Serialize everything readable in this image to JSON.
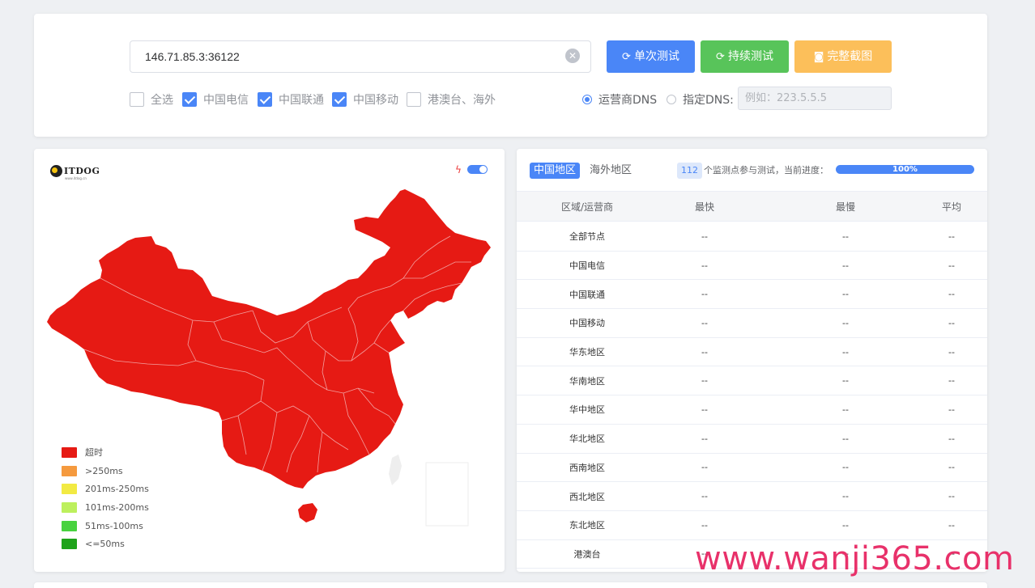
{
  "top": {
    "ip_value": "146.71.85.3:36122",
    "buttons": {
      "single": "单次测试",
      "continuous": "持续测试",
      "screenshot": "完整截图"
    },
    "checkboxes": [
      {
        "label": "全选",
        "checked": false
      },
      {
        "label": "中国电信",
        "checked": true
      },
      {
        "label": "中国联通",
        "checked": true
      },
      {
        "label": "中国移动",
        "checked": true
      },
      {
        "label": "港澳台、海外",
        "checked": false
      }
    ],
    "dns": {
      "option1": "运营商DNS",
      "option2": "指定DNS:",
      "placeholder": "例如：223.5.5.5",
      "selected": "运营商DNS"
    }
  },
  "map": {
    "logo": "ITDOG",
    "logo_sub": "www.itdog.cn",
    "fill_color": "#e61a14",
    "legend": [
      {
        "label": "超时",
        "color": "#e61a14"
      },
      {
        "label": ">250ms",
        "color": "#f59a3e"
      },
      {
        "label": "201ms-250ms",
        "color": "#f2ea43"
      },
      {
        "label": "101ms-200ms",
        "color": "#bdf05d"
      },
      {
        "label": "51ms-100ms",
        "color": "#48d23f"
      },
      {
        "label": "<=50ms",
        "color": "#1ea31a"
      }
    ]
  },
  "results": {
    "tabs": [
      "中国地区",
      "海外地区"
    ],
    "active_tab": "中国地区",
    "node_count": "112",
    "count_text": "个监测点参与测试，当前进度：",
    "progress": "100%",
    "progress_value": 1.0,
    "columns": [
      "区域/运营商",
      "最快",
      "最慢",
      "平均"
    ],
    "rows": [
      {
        "region": "全部节点",
        "fastest": "--",
        "slowest": "--",
        "average": "--"
      },
      {
        "region": "中国电信",
        "fastest": "--",
        "slowest": "--",
        "average": "--"
      },
      {
        "region": "中国联通",
        "fastest": "--",
        "slowest": "--",
        "average": "--"
      },
      {
        "region": "中国移动",
        "fastest": "--",
        "slowest": "--",
        "average": "--"
      },
      {
        "region": "华东地区",
        "fastest": "--",
        "slowest": "--",
        "average": "--"
      },
      {
        "region": "华南地区",
        "fastest": "--",
        "slowest": "--",
        "average": "--"
      },
      {
        "region": "华中地区",
        "fastest": "--",
        "slowest": "--",
        "average": "--"
      },
      {
        "region": "华北地区",
        "fastest": "--",
        "slowest": "--",
        "average": "--"
      },
      {
        "region": "西南地区",
        "fastest": "--",
        "slowest": "--",
        "average": "--"
      },
      {
        "region": "西北地区",
        "fastest": "--",
        "slowest": "--",
        "average": "--"
      },
      {
        "region": "东北地区",
        "fastest": "--",
        "slowest": "--",
        "average": "--"
      },
      {
        "region": "港澳台",
        "fastest": "--",
        "slowest": "--",
        "average": "--"
      }
    ]
  },
  "watermark": "www.wanji365.com",
  "icons": {
    "clear": "clear-icon",
    "refresh": "refresh-icon",
    "camera": "camera-icon",
    "bolt": "bolt-icon"
  }
}
